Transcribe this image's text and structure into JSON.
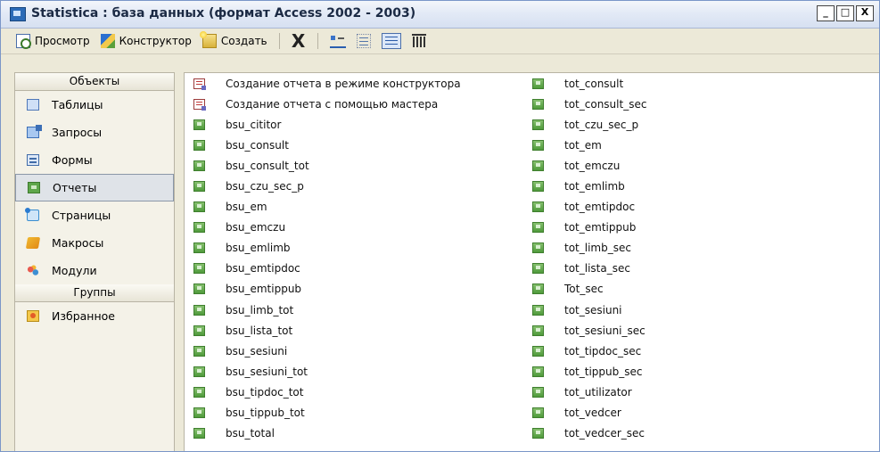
{
  "window": {
    "title": "Statistica : база данных (формат Access 2002 - 2003)",
    "buttons": [
      "_",
      "□",
      "X"
    ]
  },
  "toolbar": {
    "preview_label": "Просмотр",
    "design_label": "Конструктор",
    "create_label": "Создать",
    "delete_label": "X"
  },
  "sidebar": {
    "objects_header": "Объекты",
    "objects": [
      {
        "label": "Таблицы",
        "icon": "table-icon"
      },
      {
        "label": "Запросы",
        "icon": "query-icon"
      },
      {
        "label": "Формы",
        "icon": "form-icon"
      },
      {
        "label": "Отчеты",
        "icon": "report-icon",
        "selected": true
      },
      {
        "label": "Страницы",
        "icon": "page-icon"
      },
      {
        "label": "Макросы",
        "icon": "macro-icon"
      },
      {
        "label": "Модули",
        "icon": "module-icon"
      }
    ],
    "groups_header": "Группы",
    "groups": [
      {
        "label": "Избранное",
        "icon": "favorites-icon"
      }
    ]
  },
  "list": {
    "col1": [
      {
        "label": "Создание отчета в режиме конструктора",
        "icon": "wizard"
      },
      {
        "label": "Создание отчета с помощью мастера",
        "icon": "wizard"
      },
      {
        "label": "bsu_cititor",
        "icon": "report"
      },
      {
        "label": "bsu_consult",
        "icon": "report"
      },
      {
        "label": "bsu_consult_tot",
        "icon": "report"
      },
      {
        "label": "bsu_czu_sec_p",
        "icon": "report"
      },
      {
        "label": "bsu_em",
        "icon": "report"
      },
      {
        "label": "bsu_emczu",
        "icon": "report"
      },
      {
        "label": "bsu_emlimb",
        "icon": "report"
      },
      {
        "label": "bsu_emtipdoc",
        "icon": "report"
      },
      {
        "label": "bsu_emtippub",
        "icon": "report"
      },
      {
        "label": "bsu_limb_tot",
        "icon": "report"
      },
      {
        "label": "bsu_lista_tot",
        "icon": "report"
      },
      {
        "label": "bsu_sesiuni",
        "icon": "report"
      },
      {
        "label": "bsu_sesiuni_tot",
        "icon": "report"
      },
      {
        "label": "bsu_tipdoc_tot",
        "icon": "report"
      },
      {
        "label": "bsu_tippub_tot",
        "icon": "report"
      },
      {
        "label": "bsu_total",
        "icon": "report"
      }
    ],
    "col2": [
      {
        "label": "tot_consult",
        "icon": "report"
      },
      {
        "label": "tot_consult_sec",
        "icon": "report"
      },
      {
        "label": "tot_czu_sec_p",
        "icon": "report"
      },
      {
        "label": "tot_em",
        "icon": "report"
      },
      {
        "label": "tot_emczu",
        "icon": "report"
      },
      {
        "label": "tot_emlimb",
        "icon": "report"
      },
      {
        "label": "tot_emtipdoc",
        "icon": "report"
      },
      {
        "label": "tot_emtippub",
        "icon": "report"
      },
      {
        "label": "tot_limb_sec",
        "icon": "report"
      },
      {
        "label": "tot_lista_sec",
        "icon": "report"
      },
      {
        "label": "Tot_sec",
        "icon": "report"
      },
      {
        "label": "tot_sesiuni",
        "icon": "report"
      },
      {
        "label": "tot_sesiuni_sec",
        "icon": "report"
      },
      {
        "label": "tot_tipdoc_sec",
        "icon": "report"
      },
      {
        "label": "tot_tippub_sec",
        "icon": "report"
      },
      {
        "label": "tot_utilizator",
        "icon": "report"
      },
      {
        "label": "tot_vedcer",
        "icon": "report"
      },
      {
        "label": "tot_vedcer_sec",
        "icon": "report"
      }
    ]
  }
}
